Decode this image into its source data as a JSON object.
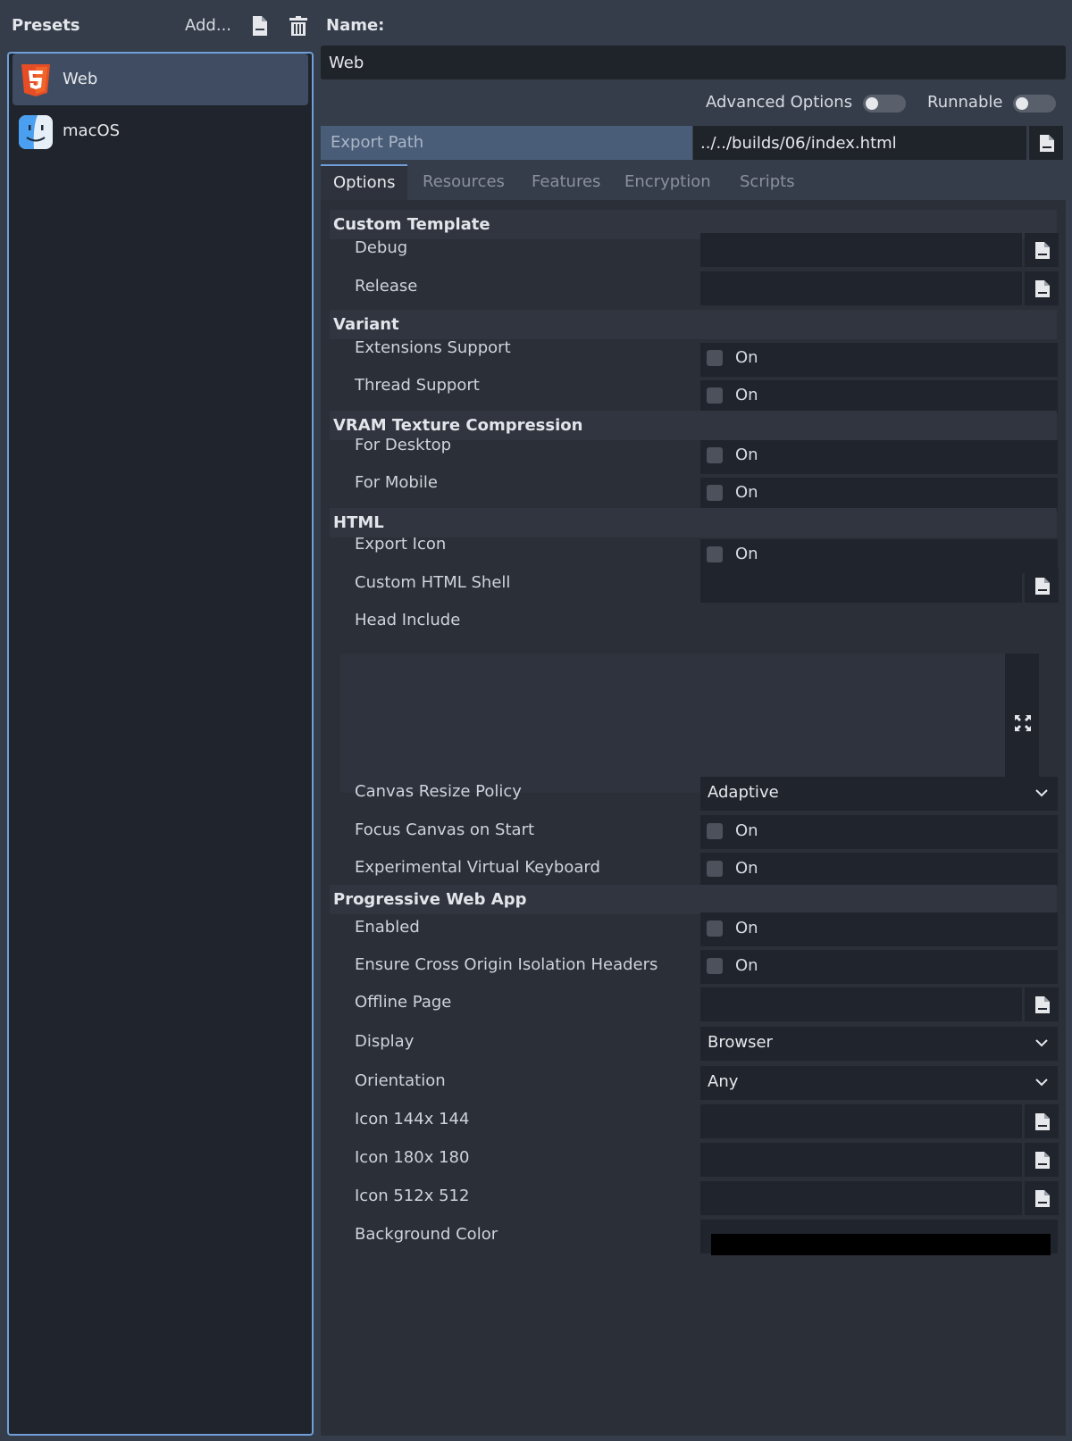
{
  "presets_panel": {
    "title": "Presets",
    "add_label": "Add...",
    "duplicate_icon": "duplicate-file-icon",
    "delete_icon": "trash-icon",
    "items": [
      {
        "label": "Web",
        "icon": "html5-icon",
        "selected": true
      },
      {
        "label": "macOS",
        "icon": "finder-icon",
        "selected": false
      }
    ]
  },
  "name": {
    "label": "Name:",
    "value": "Web"
  },
  "toggles": {
    "advanced_options": "Advanced Options",
    "runnable": "Runnable"
  },
  "export_path": {
    "label": "Export Path",
    "value": "../../builds/06/index.html"
  },
  "tabs": [
    "Options",
    "Resources",
    "Features",
    "Encryption",
    "Scripts"
  ],
  "options": {
    "custom_template": {
      "title": "Custom Template",
      "debug": "Debug",
      "release": "Release"
    },
    "variant": {
      "title": "Variant",
      "extensions_support": "Extensions Support",
      "thread_support": "Thread Support"
    },
    "vram": {
      "title": "VRAM Texture Compression",
      "for_desktop": "For Desktop",
      "for_mobile": "For Mobile"
    },
    "html": {
      "title": "HTML",
      "export_icon": "Export Icon",
      "custom_html_shell": "Custom HTML Shell",
      "head_include": "Head Include",
      "canvas_resize_policy": "Canvas Resize Policy",
      "canvas_resize_policy_value": "Adaptive",
      "focus_canvas": "Focus Canvas on Start",
      "virtual_keyboard": "Experimental Virtual Keyboard"
    },
    "pwa": {
      "title": "Progressive Web App",
      "enabled": "Enabled",
      "cross_origin": "Ensure Cross Origin Isolation Headers",
      "offline_page": "Offline Page",
      "display": "Display",
      "display_value": "Browser",
      "orientation": "Orientation",
      "orientation_value": "Any",
      "icon_144": "Icon 144x 144",
      "icon_180": "Icon 180x 180",
      "icon_512": "Icon 512x 512",
      "background_color": "Background Color",
      "background_color_value": "#000000"
    },
    "on_text": "On"
  },
  "colors": {
    "accent": "#6f9fd8",
    "selected_preset": "#3f4c61",
    "html5_orange": "#e44d26",
    "finder_blue": "#4a9ff0"
  }
}
